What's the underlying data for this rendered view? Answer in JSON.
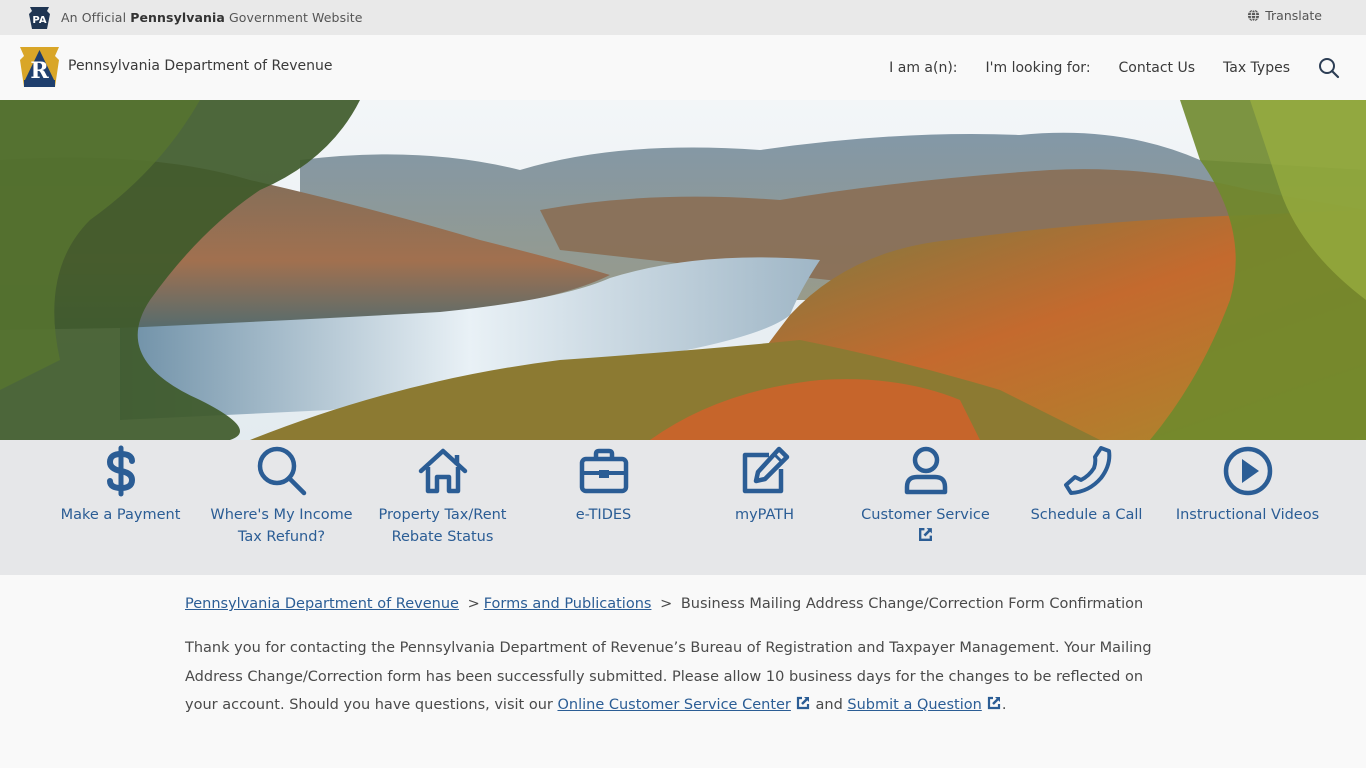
{
  "topbar": {
    "badge_text": "PA",
    "official_prefix": "An Official",
    "official_state": "Pennsylvania",
    "official_suffix": "Government Website",
    "translate_label": "Translate"
  },
  "header": {
    "logo_letter": "R",
    "department_name": "Pennsylvania Department of Revenue",
    "nav": [
      {
        "label": "I am a(n):"
      },
      {
        "label": "I'm looking for:"
      },
      {
        "label": "Contact Us"
      },
      {
        "label": "Tax Types"
      }
    ],
    "search_icon": "search-icon"
  },
  "hero": {
    "description": "Autumn river valley with forested hills"
  },
  "quick_links": [
    {
      "label": "Make a Payment",
      "icon": "dollar-icon",
      "external": false
    },
    {
      "label": "Where's My Income Tax Refund?",
      "icon": "magnifier-icon",
      "external": false
    },
    {
      "label": "Property Tax/Rent Rebate Status",
      "icon": "house-icon",
      "external": false
    },
    {
      "label": "e-TIDES",
      "icon": "briefcase-icon",
      "external": false
    },
    {
      "label": "myPATH",
      "icon": "edit-icon",
      "external": false
    },
    {
      "label": "Customer Service",
      "icon": "user-icon",
      "external": true
    },
    {
      "label": "Schedule a Call",
      "icon": "phone-icon",
      "external": false
    },
    {
      "label": "Instructional Videos",
      "icon": "play-circle-icon",
      "external": false
    }
  ],
  "breadcrumb": {
    "items": [
      {
        "label": "Pennsylvania Department of Revenue"
      },
      {
        "label": "Forms and Publications"
      }
    ],
    "separator": ">",
    "current": "Business Mailing Address Change/Correction Form Confirmation"
  },
  "message": {
    "text_1": "Thank you for contacting the Pennsylvania Department of Revenue’s Bureau of Registration and Taxpayer Management. Your Mailing Address Change/Correction form has been successfully submitted.  Please allow 10 business days for the changes to be reflected on your account. Should you have questions, visit our ",
    "link_1": "Online Customer Service Center",
    "text_2": " and ",
    "link_2": "Submit a Question",
    "text_3": "."
  },
  "colors": {
    "brand_blue": "#2b5d95",
    "logo_gold": "#d9a628",
    "logo_navy": "#1f3f6e",
    "topbar_bg": "#e9e9e9",
    "quicklinks_bg": "#e6e7e9"
  }
}
